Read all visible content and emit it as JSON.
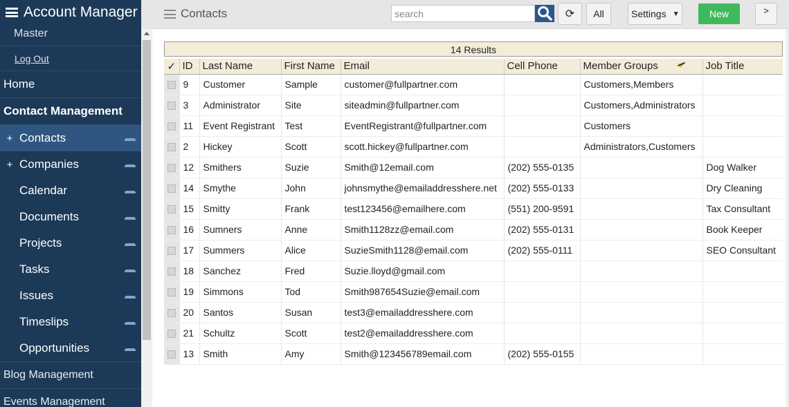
{
  "sidebar": {
    "app_title": "Account Manager",
    "user": "Master",
    "logout": "Log Out",
    "home": "Home",
    "section": "Contact Management",
    "items": [
      {
        "label": "Contacts",
        "plus": "+"
      },
      {
        "label": "Companies",
        "plus": "+"
      },
      {
        "label": "Calendar",
        "plus": ""
      },
      {
        "label": "Documents",
        "plus": ""
      },
      {
        "label": "Projects",
        "plus": ""
      },
      {
        "label": "Tasks",
        "plus": ""
      },
      {
        "label": "Issues",
        "plus": ""
      },
      {
        "label": "Timeslips",
        "plus": ""
      },
      {
        "label": "Opportunities",
        "plus": ""
      }
    ],
    "blog": "Blog Management",
    "events": "Events Management"
  },
  "topbar": {
    "title": "Contacts",
    "search_placeholder": "search",
    "refresh": "⟳",
    "all": "All",
    "settings": "Settings",
    "settings_caret": "▼",
    "new": "New",
    "next": ">"
  },
  "table": {
    "results": "14 Results",
    "check_header": "✓",
    "columns": [
      "ID",
      "Last Name",
      "First Name",
      "Email",
      "Cell Phone",
      "Member Groups",
      "Job Title"
    ],
    "rows": [
      [
        "9",
        "Customer",
        "Sample",
        "customer@fullpartner.com",
        "",
        "Customers,Members",
        ""
      ],
      [
        "3",
        "Administrator",
        "Site",
        "siteadmin@fullpartner.com",
        "",
        "Customers,Administrators",
        ""
      ],
      [
        "11",
        "Event Registrant",
        "Test",
        "EventRegistrant@fullpartner.com",
        "",
        "Customers",
        ""
      ],
      [
        "2",
        "Hickey",
        "Scott",
        "scott.hickey@fullpartner.com",
        "",
        "Administrators,Customers",
        ""
      ],
      [
        "12",
        "Smithers",
        "Suzie",
        "Smith@12email.com",
        "(202) 555-0135",
        "",
        "Dog Walker"
      ],
      [
        "14",
        "Smythe",
        "John",
        "johnsmythe@emailaddresshere.net",
        "(202) 555-0133",
        "",
        "Dry Cleaning"
      ],
      [
        "15",
        "Smitty",
        "Frank",
        "test123456@emailhere.com",
        "(551) 200-9591",
        "",
        "Tax Consultant"
      ],
      [
        "16",
        "Sumners",
        "Anne",
        "Smith1128zz@email.com",
        "(202) 555-0131",
        "",
        "Book Keeper"
      ],
      [
        "17",
        "Summers",
        "Alice",
        "SuzieSmith1128@email.com",
        "(202) 555-0111",
        "",
        "SEO Consultant"
      ],
      [
        "18",
        "Sanchez",
        "Fred",
        "Suzie.lloyd@gmail.com",
        "",
        "",
        ""
      ],
      [
        "19",
        "Simmons",
        "Tod",
        "Smith987654Suzie@email.com",
        "",
        "",
        ""
      ],
      [
        "20",
        "Santos",
        "Susan",
        "test3@emailaddresshere.com",
        "",
        "",
        ""
      ],
      [
        "21",
        "Schultz",
        "Scott",
        "test2@emailaddresshere.com",
        "",
        "",
        ""
      ],
      [
        "13",
        "Smith",
        "Amy",
        "Smith@123456789email.com",
        "(202) 555-0155",
        "",
        ""
      ]
    ]
  }
}
